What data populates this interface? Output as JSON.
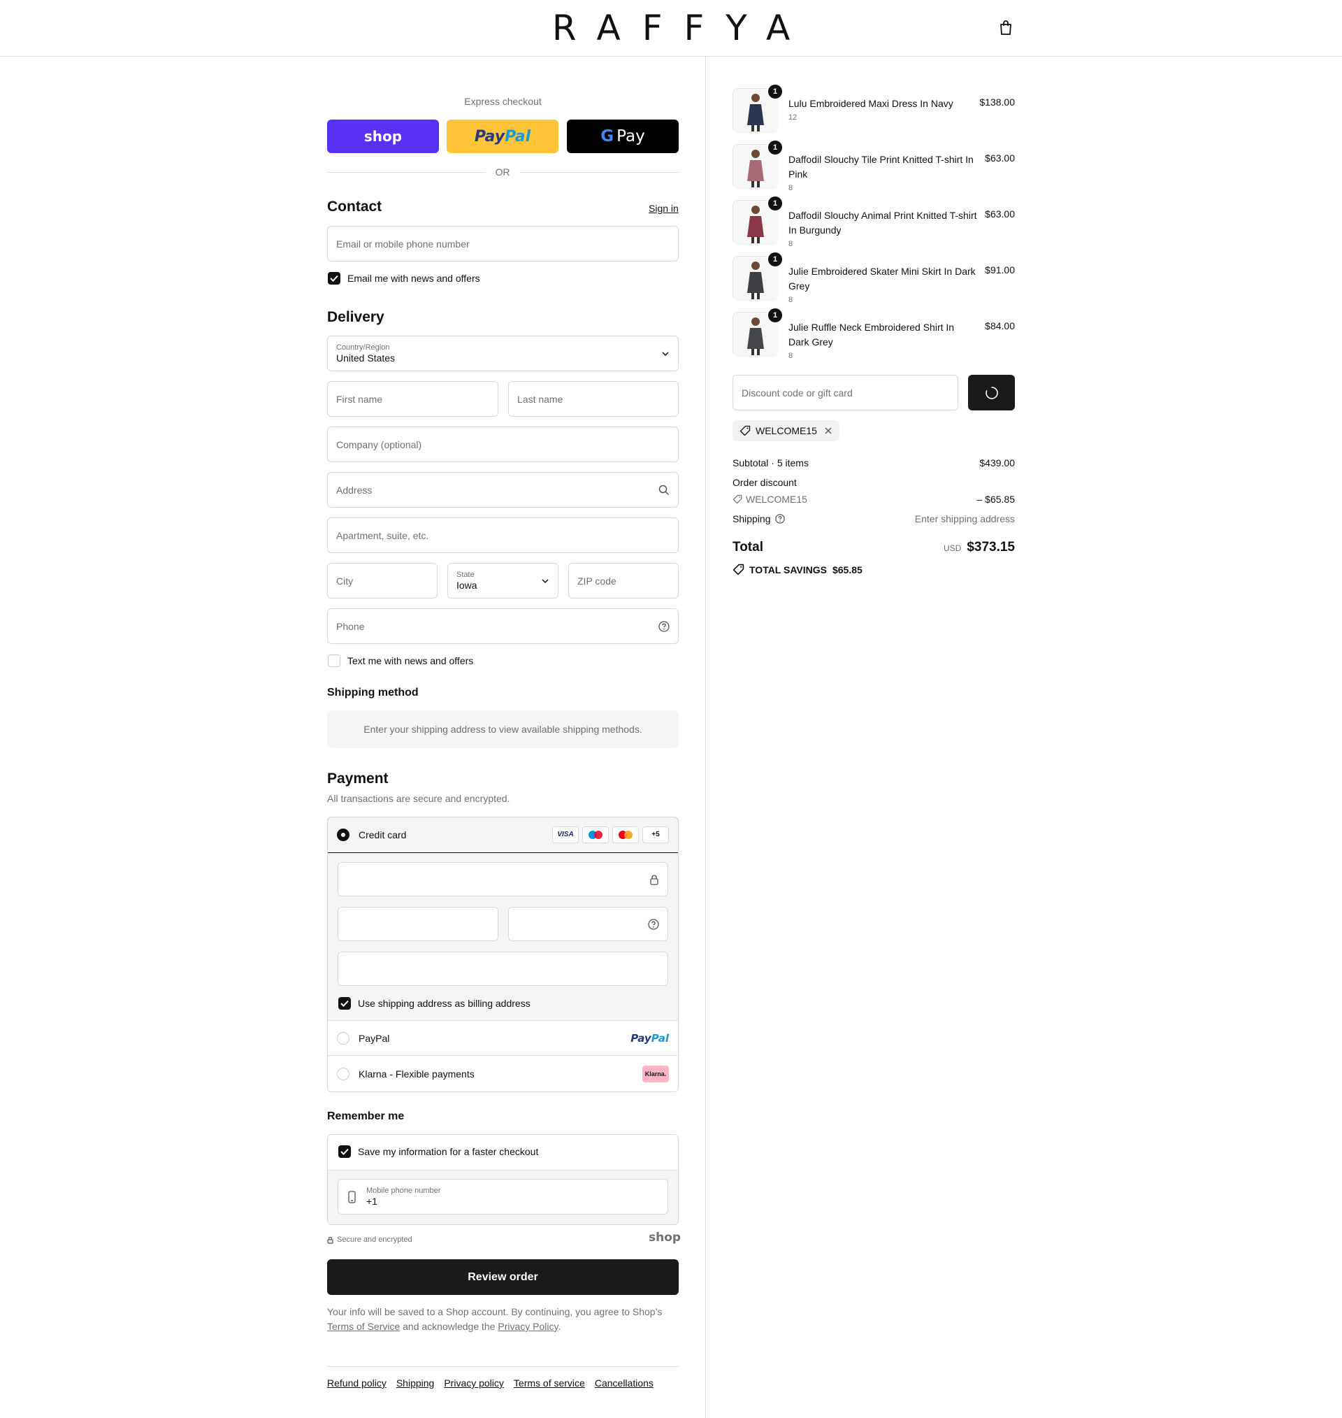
{
  "header": {
    "brand": "RAFFYA"
  },
  "express": {
    "label": "Express checkout",
    "shop_label": "shop",
    "paypal_label_1": "Pay",
    "paypal_label_2": "Pal",
    "gpay_label": "Pay",
    "or_label": "OR"
  },
  "contact": {
    "heading": "Contact",
    "sign_in": "Sign in",
    "email_placeholder": "Email or mobile phone number",
    "news_label": "Email me with news and offers"
  },
  "delivery": {
    "heading": "Delivery",
    "country_label": "Country/Region",
    "country_value": "United States",
    "first_name": "First name",
    "last_name": "Last name",
    "company": "Company (optional)",
    "address": "Address",
    "apartment": "Apartment, suite, etc.",
    "city": "City",
    "state_label": "State",
    "state_value": "Iowa",
    "zip": "ZIP code",
    "phone": "Phone",
    "text_label": "Text me with news and offers"
  },
  "shipping_method": {
    "heading": "Shipping method",
    "notice": "Enter your shipping address to view available shipping methods."
  },
  "payment": {
    "heading": "Payment",
    "subtitle": "All transactions are secure and encrypted.",
    "credit_card": "Credit card",
    "card_visa": "VISA",
    "card_more": "+5",
    "billing_label": "Use shipping address as billing address",
    "paypal": "PayPal",
    "paypal_logo_1": "Pay",
    "paypal_logo_2": "Pal",
    "klarna": "Klarna - Flexible payments",
    "klarna_logo": "Klarna."
  },
  "remember": {
    "heading": "Remember me",
    "save_label": "Save my information for a faster checkout",
    "mobile_label": "Mobile phone number",
    "mobile_value": "+1",
    "secure": "Secure and encrypted",
    "shop": "shop"
  },
  "review_button": "Review order",
  "legal": {
    "text1": "Your info will be saved to a Shop account. By continuing, you agree to Shop’s",
    "terms": "Terms of Service",
    "text2": "and acknowledge the",
    "privacy": "Privacy Policy",
    "text3": "."
  },
  "footer_links": [
    "Refund policy",
    "Shipping",
    "Privacy policy",
    "Terms of service",
    "Cancellations"
  ],
  "cart": {
    "items": [
      {
        "name": "Lulu Embroidered Maxi Dress In Navy",
        "variant": "12",
        "price": "$138.00",
        "qty": "1",
        "color": "#2c3550"
      },
      {
        "name": "Daffodil Slouchy Tile Print Knitted T-shirt In Pink",
        "variant": "8",
        "price": "$63.00",
        "qty": "1",
        "color": "#a86a74"
      },
      {
        "name": "Daffodil Slouchy Animal Print Knitted T-shirt In Burgundy",
        "variant": "8",
        "price": "$63.00",
        "qty": "1",
        "color": "#8a3848"
      },
      {
        "name": "Julie Embroidered Skater Mini Skirt In Dark Grey",
        "variant": "8",
        "price": "$91.00",
        "qty": "1",
        "color": "#3f3f44"
      },
      {
        "name": "Julie Ruffle Neck Embroidered Shirt In Dark Grey",
        "variant": "8",
        "price": "$84.00",
        "qty": "1",
        "color": "#45454c"
      }
    ],
    "discount_placeholder": "Discount code or gift card",
    "applied_code": "WELCOME15",
    "subtotal_label": "Subtotal · 5 items",
    "subtotal_value": "$439.00",
    "order_discount_label": "Order discount",
    "order_discount_code": "WELCOME15",
    "order_discount_value": "– $65.85",
    "shipping_label": "Shipping",
    "shipping_value": "Enter shipping address",
    "total_label": "Total",
    "currency": "USD",
    "total_value": "$373.15",
    "savings_label": "TOTAL SAVINGS",
    "savings_value": "$65.85"
  }
}
